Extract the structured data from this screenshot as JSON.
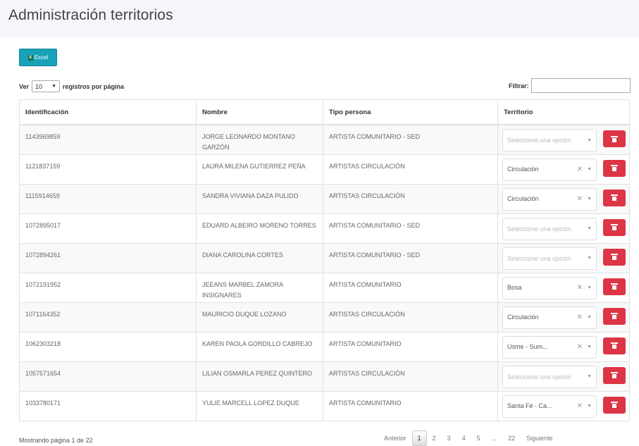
{
  "page": {
    "title": "Administración territorios"
  },
  "toolbar": {
    "excel_label": "Excel"
  },
  "length": {
    "prefix": "Ver",
    "value": "10",
    "suffix": "registros por página"
  },
  "filter": {
    "label": "Filtrar:",
    "value": ""
  },
  "table": {
    "headers": [
      "Identificación",
      "Nombre",
      "Tipo persona",
      "Territorio"
    ],
    "rows": [
      {
        "id": "1143969859",
        "name": "JORGE LEONARDO MONTANO GARZÓN",
        "type": "ARTISTA COMUNITARIO - SED",
        "territory": "Seleccione una opción",
        "territory_selected": false
      },
      {
        "id": "1121837159",
        "name": "LAURA MILENA GUTIERREZ PEÑA",
        "type": "ARTISTAS CIRCULACIÓN",
        "territory": "Circulación",
        "territory_selected": true
      },
      {
        "id": "1115914659",
        "name": "SANDRA VIVIANA DAZA PULIDO",
        "type": "ARTISTAS CIRCULACIÓN",
        "territory": "Circulación",
        "territory_selected": true
      },
      {
        "id": "1072895017",
        "name": "EDUARD ALBEIRO MORENO TORRES",
        "type": "ARTISTA COMUNITARIO - SED",
        "territory": "Seleccione una opción",
        "territory_selected": false
      },
      {
        "id": "1072894261",
        "name": "DIANA CAROLINA CORTES",
        "type": "ARTISTA COMUNITARIO - SED",
        "territory": "Seleccione una opción",
        "territory_selected": false
      },
      {
        "id": "1072191952",
        "name": "JEEANS MARBEL ZAMORA INSIGNARES",
        "type": "ARTISTA COMUNITARIO",
        "territory": "Bosa",
        "territory_selected": true
      },
      {
        "id": "1071164352",
        "name": "MAURICIO DUQUE LOZANO",
        "type": "ARTISTAS CIRCULACIÓN",
        "territory": "Circulación",
        "territory_selected": true
      },
      {
        "id": "1062303218",
        "name": "KAREN PAOLA GORDILLO CABREJO",
        "type": "ARTISTA COMUNITARIO",
        "territory": "Usme - Sum...",
        "territory_selected": true
      },
      {
        "id": "1057571654",
        "name": "LILIAN OSMARLA PEREZ QUINTERO",
        "type": "ARTISTAS CIRCULACIÓN",
        "territory": "Seleccione una opción",
        "territory_selected": false
      },
      {
        "id": "1033780171",
        "name": "YULIE MARCELL LOPEZ DUQUE",
        "type": "ARTISTA COMUNITARIO",
        "territory": "Santa Fé - Ca...",
        "territory_selected": true
      }
    ]
  },
  "footer": {
    "info": "Mostrando página 1 de 22"
  },
  "pagination": {
    "previous": "Anterior",
    "pages": [
      "1",
      "2",
      "3",
      "4",
      "5",
      "...",
      "22"
    ],
    "current": "1",
    "next": "Siguiente"
  },
  "icons": {
    "clear": "close-icon",
    "dropdown": "chevron-down-icon",
    "delete": "trash-icon",
    "excel": "excel-icon"
  },
  "colors": {
    "excel_button": "#17a2b8",
    "delete_button": "#dc3545",
    "header_bg": "#f4f6f9"
  }
}
